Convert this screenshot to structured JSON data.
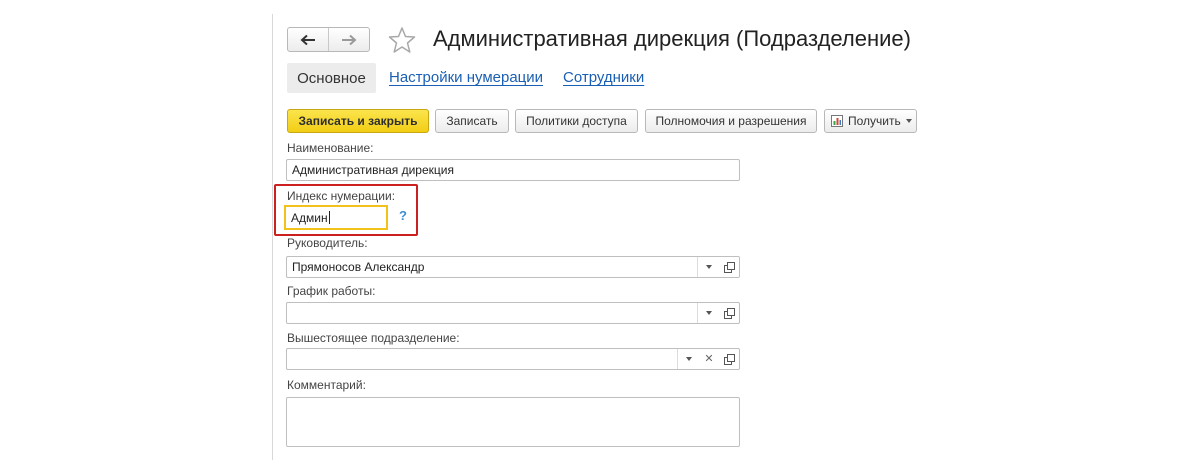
{
  "header": {
    "title": "Административная дирекция (Подразделение)",
    "back_icon": "arrow-left-icon",
    "forward_icon": "arrow-right-icon",
    "favorite_icon": "star-icon"
  },
  "tabs": [
    {
      "label": "Основное",
      "active": true
    },
    {
      "label": "Настройки нумерации",
      "active": false
    },
    {
      "label": "Сотрудники",
      "active": false
    }
  ],
  "toolbar": {
    "save_close_label": "Записать и закрыть",
    "save_label": "Записать",
    "access_policies_label": "Политики доступа",
    "permissions_label": "Полномочия и разрешения",
    "get_label": "Получить",
    "get_icon": "report-icon"
  },
  "form": {
    "name_label": "Наименование:",
    "name_value": "Административная дирекция",
    "index_label": "Индекс нумерации:",
    "index_value": "Админ",
    "index_help": "?",
    "manager_label": "Руководитель:",
    "manager_value": "Прямоносов Александр",
    "schedule_label": "График работы:",
    "schedule_value": "",
    "parent_label": "Вышестоящее подразделение:",
    "parent_value": "",
    "comment_label": "Комментарий:",
    "comment_value": ""
  },
  "colors": {
    "primary_button": "#f2cd14",
    "link": "#1a5fb4",
    "highlight": "#cc1f1f",
    "focus": "#f2c21b"
  }
}
